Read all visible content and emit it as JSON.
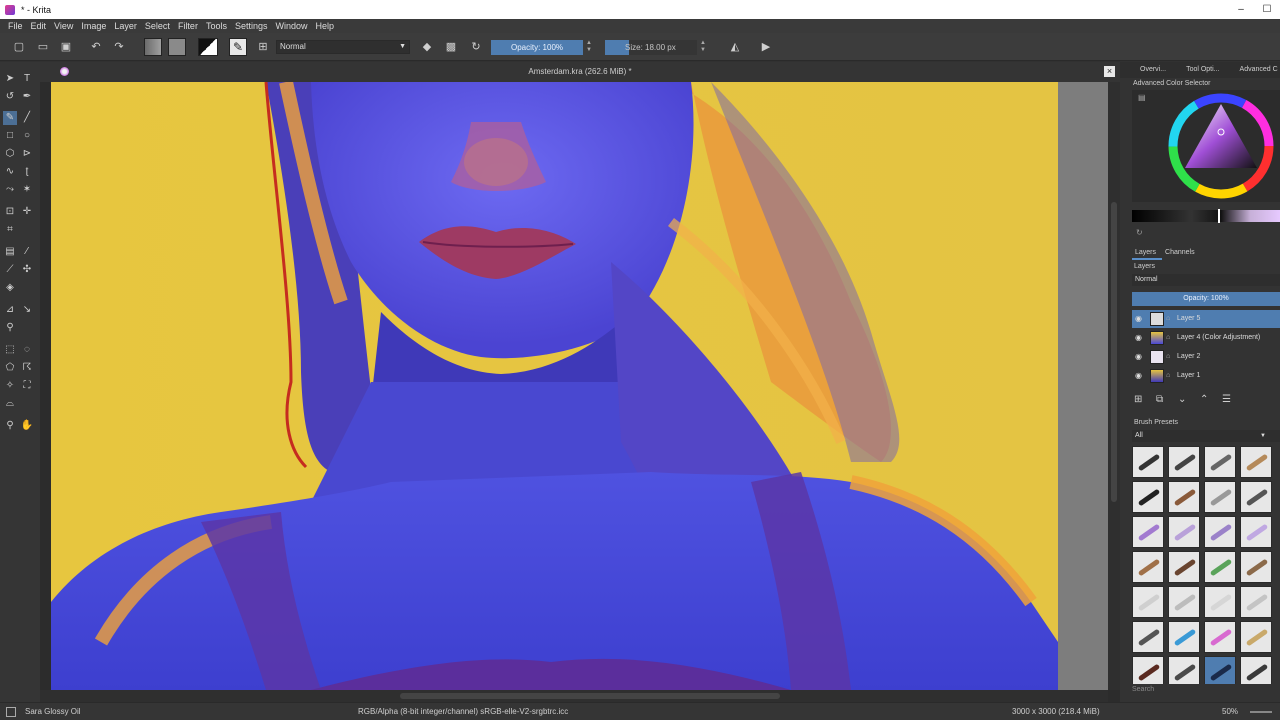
{
  "window": {
    "title": "* - Krita",
    "controls": [
      "–",
      "☐"
    ]
  },
  "menu": {
    "items": [
      "File",
      "Edit",
      "View",
      "Image",
      "Layer",
      "Select",
      "Filter",
      "Tools",
      "Settings",
      "Window",
      "Help"
    ]
  },
  "toolbar": {
    "blend_mode": "Normal",
    "opacity_label": "Opacity:  100%",
    "size_label": "Size:  18.00 px"
  },
  "document": {
    "title": "Amsterdam.kra (262.6 MiB) *"
  },
  "dockers": {
    "tabs": [
      "Overvi...",
      "Tool Opti...",
      "Advanced C"
    ],
    "color_selector_title": "Advanced Color Selector",
    "layers_tabs": [
      "Layers",
      "Channels"
    ],
    "layers_label": "Layers",
    "layer_blend_mode": "Normal",
    "layer_opacity": "Opacity:  100%",
    "layers": [
      {
        "name": "Layer 5",
        "active": true
      },
      {
        "name": "Layer 4 (Color Adjustment)",
        "active": false
      },
      {
        "name": "Layer 2",
        "active": false
      },
      {
        "name": "Layer 1",
        "active": false
      }
    ],
    "brush_presets_title": "Brush Presets",
    "brush_filter": "All",
    "brush_search": "Search"
  },
  "status": {
    "brush_name": "Sara Glossy Oil",
    "color_profile": "RGB/Alpha (8-bit integer/channel)  sRGB-elle-V2-srgbtrc.icc",
    "image_size": "3000 x 3000 (218.4 MiB)",
    "zoom": "50%"
  },
  "colors": {
    "accent": "#4f7db0",
    "background_yellow": "#e6c33f",
    "skin_blue": "#4a48d6",
    "hair_orange": "#f0a33a"
  }
}
